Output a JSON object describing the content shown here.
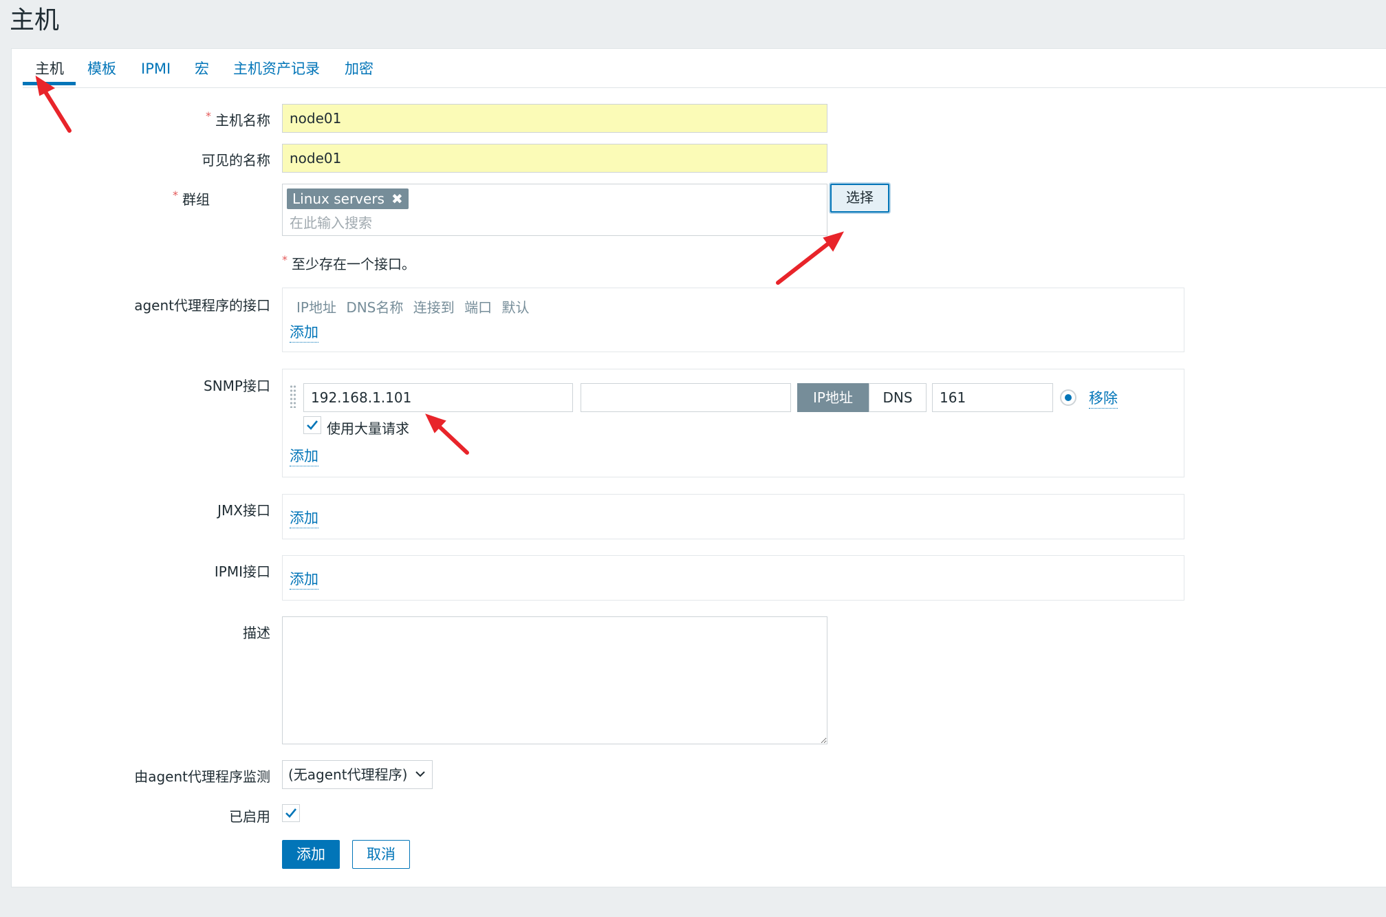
{
  "page": {
    "title": "主机"
  },
  "tabs": [
    {
      "label": "主机"
    },
    {
      "label": "模板"
    },
    {
      "label": "IPMI"
    },
    {
      "label": "宏"
    },
    {
      "label": "主机资产记录"
    },
    {
      "label": "加密"
    }
  ],
  "form": {
    "host_name": {
      "label": "主机名称",
      "required_mark": "*",
      "value": "node01"
    },
    "visible_name": {
      "label": "可见的名称",
      "value": "node01"
    },
    "groups": {
      "label": "群组",
      "required_mark": "*",
      "chip": "Linux servers",
      "chip_remove": "✖",
      "placeholder": "在此输入搜索",
      "select_button": "选择"
    },
    "interface_note": {
      "required_mark": "*",
      "text": "至少存在一个接口。"
    },
    "agent_interfaces": {
      "label": "agent代理程序的接口",
      "columns": "IP地址 DNS名称 连接到 端口 默认",
      "add_link": "添加"
    },
    "snmp_interfaces": {
      "label": "SNMP接口",
      "ip_value": "192.168.1.101",
      "dns_value": "",
      "connect_ip": "IP地址",
      "connect_dns": "DNS",
      "port_value": "161",
      "remove_link": "移除",
      "bulk_label": "使用大量请求",
      "bulk_checked": true,
      "add_link": "添加"
    },
    "jmx_interfaces": {
      "label": "JMX接口",
      "add_link": "添加"
    },
    "ipmi_interfaces": {
      "label": "IPMI接口",
      "add_link": "添加"
    },
    "description": {
      "label": "描述",
      "value": ""
    },
    "monitored_by_proxy": {
      "label": "由agent代理程序监测",
      "selected": "(无agent代理程序)"
    },
    "enabled": {
      "label": "已启用",
      "checked": true
    },
    "buttons": {
      "add": "添加",
      "cancel": "取消"
    }
  },
  "colors": {
    "accent": "#0275b8",
    "required": "#e45959",
    "highlight_input": "#fbfbb7",
    "chip_bg": "#768d99",
    "annotation_arrow": "#e8242a"
  }
}
